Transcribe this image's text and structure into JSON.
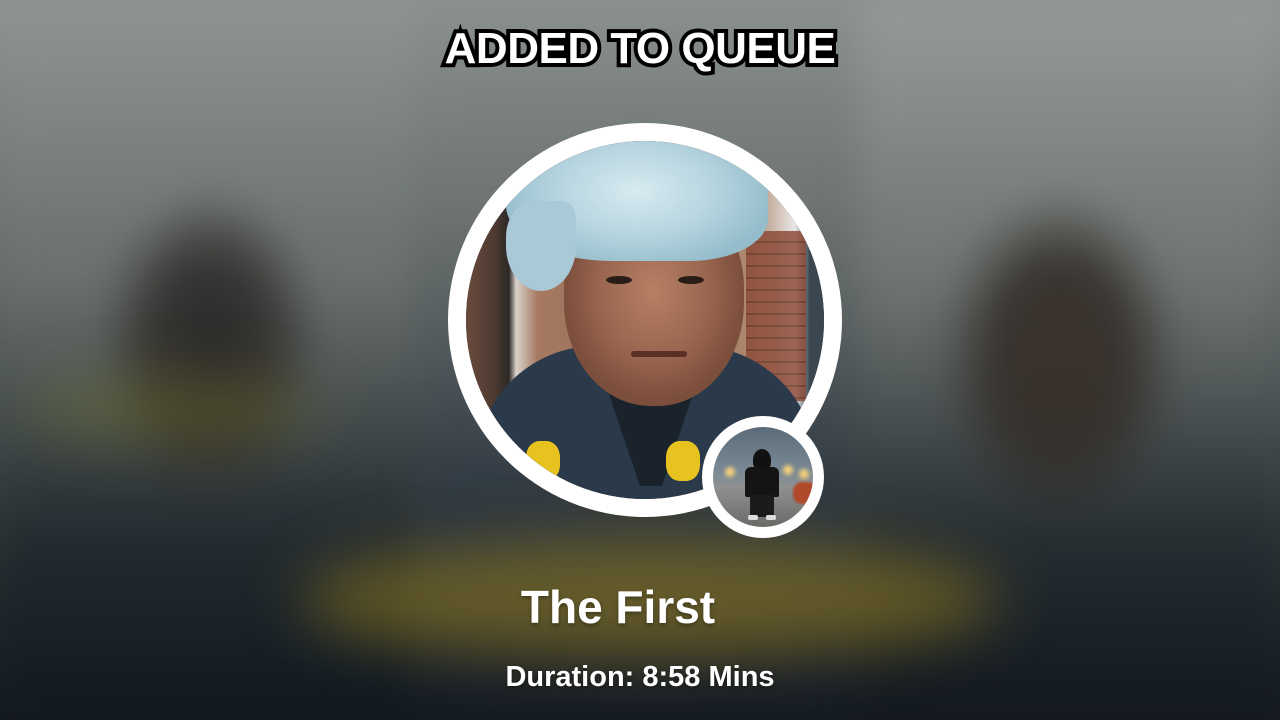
{
  "banner": {
    "title": "ADDED TO QUEUE"
  },
  "track": {
    "title": "The First",
    "duration_text": "Duration: 8:58 Mins"
  },
  "colors": {
    "text": "#ffffff",
    "outline": "#000000",
    "ring": "#ffffff"
  }
}
